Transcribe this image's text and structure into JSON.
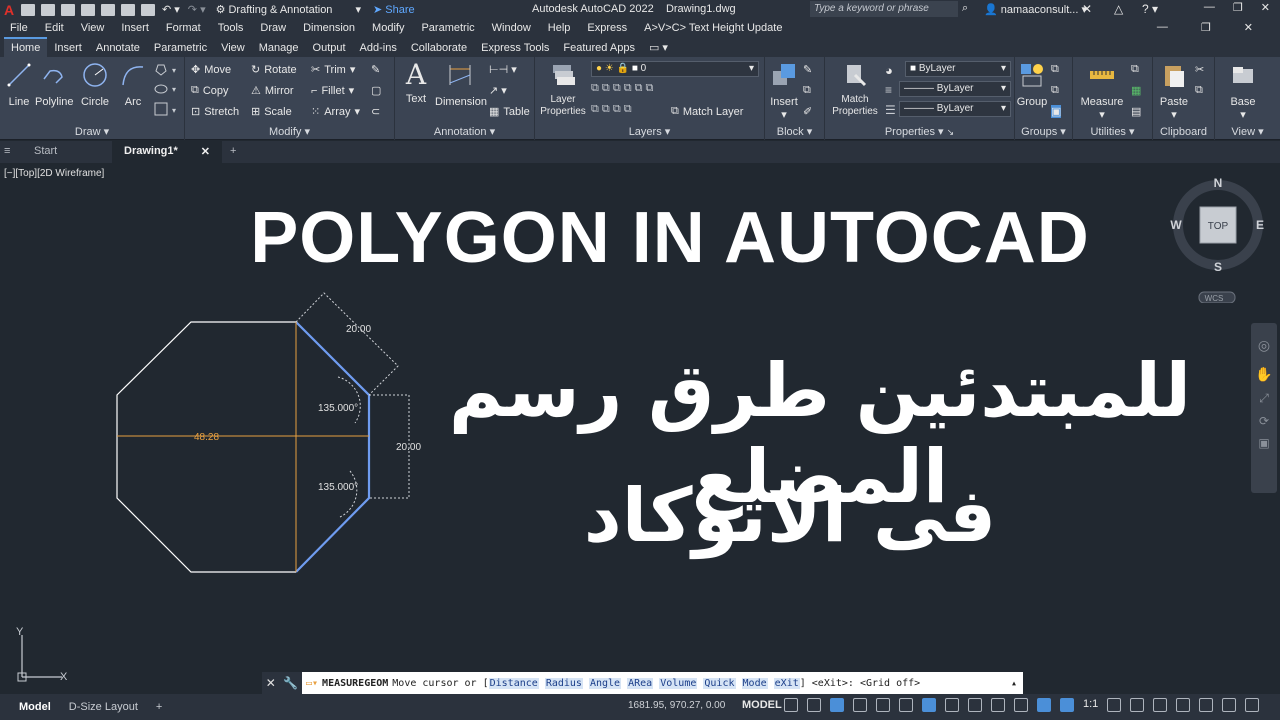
{
  "titlebar": {
    "workspace": "Drafting & Annotation",
    "share": "Share",
    "app_title": "Autodesk AutoCAD 2022",
    "file_title": "Drawing1.dwg",
    "search_placeholder": "Type a keyword or phrase",
    "user": "namaaconsult..."
  },
  "menu": [
    "File",
    "Edit",
    "View",
    "Insert",
    "Format",
    "Tools",
    "Draw",
    "Dimension",
    "Modify",
    "Parametric",
    "Window",
    "Help",
    "Express",
    "A>V>C> Text Height Update"
  ],
  "ribbon_tabs": [
    "Home",
    "Insert",
    "Annotate",
    "Parametric",
    "View",
    "Manage",
    "Output",
    "Add-ins",
    "Collaborate",
    "Express Tools",
    "Featured Apps"
  ],
  "ribbon": {
    "draw": {
      "title": "Draw",
      "line": "Line",
      "polyline": "Polyline",
      "circle": "Circle",
      "arc": "Arc"
    },
    "modify": {
      "title": "Modify",
      "move": "Move",
      "rotate": "Rotate",
      "trim": "Trim",
      "copy": "Copy",
      "mirror": "Mirror",
      "fillet": "Fillet",
      "stretch": "Stretch",
      "scale": "Scale",
      "array": "Array"
    },
    "annotation": {
      "title": "Annotation",
      "text": "Text",
      "dimension": "Dimension",
      "table": "Table"
    },
    "layers": {
      "title": "Layers",
      "layer_properties": "Layer Properties",
      "layer_value": "0",
      "match_layer": "Match Layer"
    },
    "block": {
      "title": "Block",
      "insert": "Insert"
    },
    "properties": {
      "title": "Properties",
      "match": "Match Properties",
      "bylayer1": "ByLayer",
      "bylayer2": "ByLayer",
      "bylayer3": "ByLayer"
    },
    "groups": {
      "title": "Groups",
      "group": "Group"
    },
    "utilities": {
      "title": "Utilities",
      "measure": "Measure"
    },
    "clipboard": {
      "title": "Clipboard",
      "paste": "Paste"
    },
    "view": {
      "title": "View",
      "base": "Base"
    }
  },
  "file_tabs": {
    "start": "Start",
    "drawing": "Drawing1*"
  },
  "viewport_label": "[−][Top][2D Wireframe]",
  "headline": "POLYGON IN AUTOCAD",
  "arabic_line1": "للمبتدئين طرق رسم المضلع",
  "arabic_line2": "فى الاتوكاد",
  "dimensions": {
    "side_top": "20.00",
    "side_right": "20.00",
    "width": "48.28",
    "angle1": "135.000°",
    "angle2": "135.000°"
  },
  "viewcube": {
    "n": "N",
    "s": "S",
    "e": "E",
    "w": "W",
    "face": "TOP",
    "wcs": "WCS"
  },
  "ucs": {
    "x": "X",
    "y": "Y"
  },
  "command": {
    "name": "MEASUREGEOM",
    "prompt": "Move cursor or [",
    "options": [
      "Distance",
      "Radius",
      "Angle",
      "ARea",
      "Volume",
      "Quick",
      "Mode",
      "eXit"
    ],
    "tail": "] <eXit>:  <Grid off>"
  },
  "status": {
    "model_tab": "Model",
    "layout_tab": "D-Size Layout",
    "coords": "1681.95, 970.27, 0.00",
    "model_btn": "MODEL",
    "scale": "1:1"
  },
  "colors": {
    "polygon": "#ffffff",
    "polygon_selected": "#6f9cf0",
    "dim_orange": "#e8a040",
    "accent": "#4b8fd8"
  }
}
